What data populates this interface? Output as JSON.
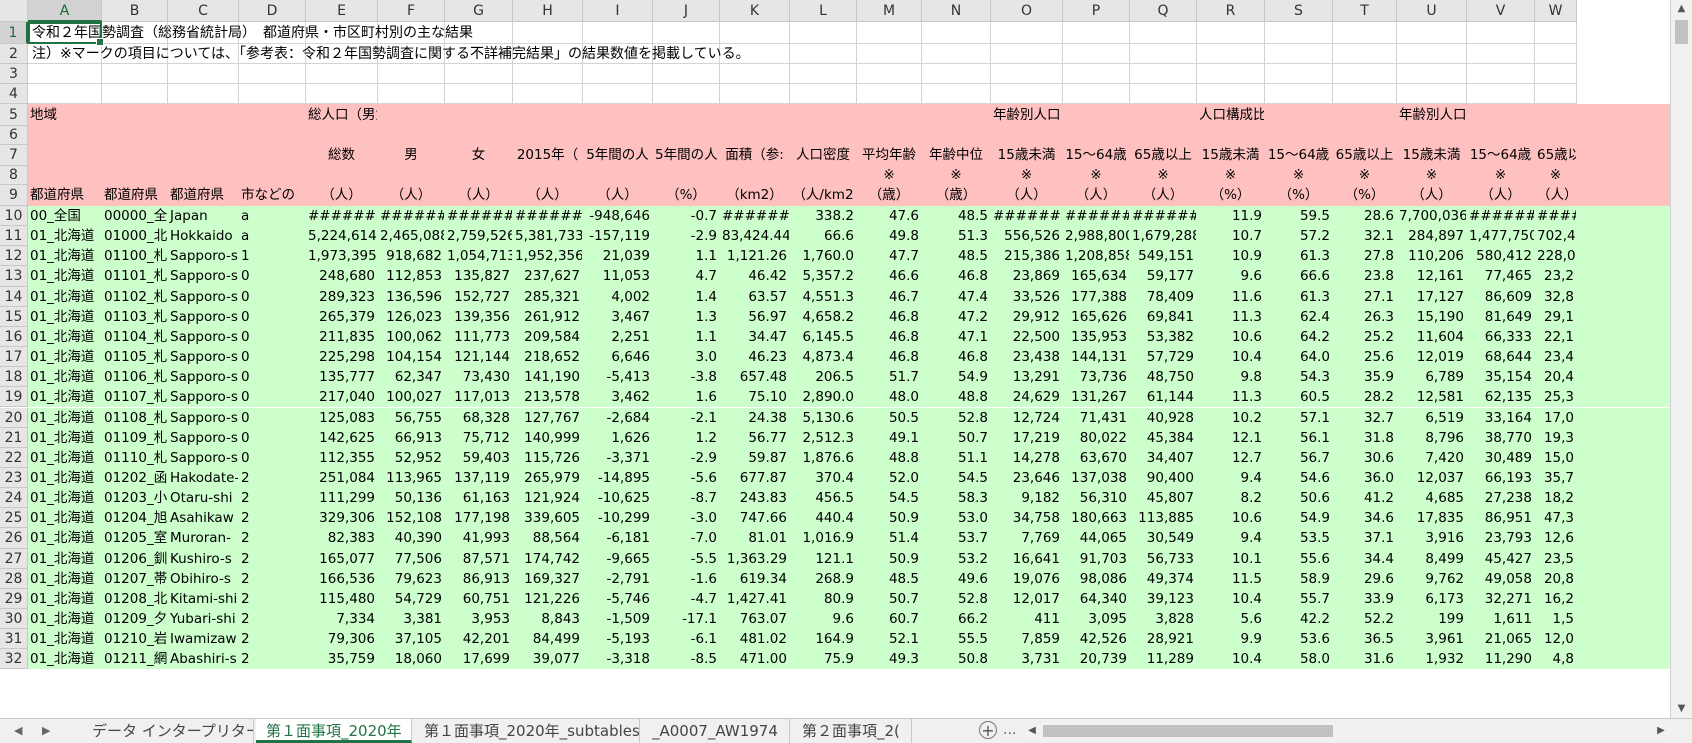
{
  "columns": [
    "A",
    "B",
    "C",
    "D",
    "E",
    "F",
    "G",
    "H",
    "I",
    "J",
    "K",
    "L",
    "M",
    "N",
    "O",
    "P",
    "Q",
    "R",
    "S",
    "T",
    "U",
    "V",
    "W"
  ],
  "selected_column": "A",
  "selected_row": "1",
  "colors": {
    "header_band": "#ffc0c0",
    "data_band": "#ccffcc",
    "accent": "#217346"
  },
  "row1_text": "令和２年国勢調査（総務省統計局）　都道府県・市区町村別の主な結果",
  "row2_text": "注）※マークの項目については、「参考表：令和２年国勢調査に関する不詳補完結果」の結果数値を掲載している。",
  "row5": {
    "A": "地域",
    "E": "総人口（男女別）",
    "O": "年齢別人口（男女「総数」）",
    "R": "人口構成比［年齢別］（男女",
    "U": "年齢別人口（男"
  },
  "row7": {
    "E": "総数",
    "F": "男",
    "G": "女",
    "H": "2015年（",
    "I": "5年間の人",
    "J": "5年間の人",
    "K": "面積（参:",
    "L": "人口密度",
    "M": "平均年齢",
    "N": "年齢中位",
    "O": "15歳未満",
    "P": "15～64歳",
    "Q": "65歳以上",
    "R": "15歳未満",
    "S": "15～64歳",
    "T": "65歳以上",
    "U": "15歳未満",
    "V": "15～64歳",
    "W": "65歳以"
  },
  "row8": {
    "M": "※",
    "N": "※",
    "O": "※",
    "P": "※",
    "Q": "※",
    "R": "※",
    "S": "※",
    "T": "※",
    "U": "※",
    "V": "※",
    "W": "※"
  },
  "row9": {
    "A": "都道府県",
    "B": "都道府県",
    "C": "都道府県",
    "D": "市などの",
    "E": "（人）",
    "F": "（人）",
    "G": "（人）",
    "H": "（人）",
    "I": "（人）",
    "J": "（%）",
    "K": "（km2）",
    "L": "（人/km2",
    "M": "（歳）",
    "N": "（歳）",
    "O": "（人）",
    "P": "（人）",
    "Q": "（人）",
    "R": "（%）",
    "S": "（%）",
    "T": "（%）",
    "U": "（人）",
    "V": "（人）",
    "W": "（人）"
  },
  "data_rows": [
    {
      "num": "10",
      "cells": [
        "00_全国",
        "00000_全",
        "Japan",
        "a",
        "########",
        "########",
        "########",
        "########",
        "-948,646",
        "-0.7",
        "########",
        "338.2",
        "47.6",
        "48.5",
        "########",
        "########",
        "########",
        "11.9",
        "59.5",
        "28.6",
        "7,700,036",
        "########",
        "#######"
      ]
    },
    {
      "num": "11",
      "cells": [
        "01_北海道",
        "01000_北",
        "Hokkaido",
        "a",
        "5,224,614",
        "2,465,088",
        "2,759,526",
        "5,381,733",
        "-157,119",
        "-2.9",
        "83,424.44",
        "66.6",
        "49.8",
        "51.3",
        "556,526",
        "2,988,800",
        "1,679,288",
        "10.7",
        "57.2",
        "32.1",
        "284,897",
        "1,477,750",
        "702,4"
      ]
    },
    {
      "num": "12",
      "cells": [
        "01_北海道",
        "01100_札",
        "Sapporo-s",
        "1",
        "1,973,395",
        "918,682",
        "1,054,713",
        "1,952,356",
        "21,039",
        "1.1",
        "1,121.26",
        "1,760.0",
        "47.7",
        "48.5",
        "215,386",
        "1,208,858",
        "549,151",
        "10.9",
        "61.3",
        "27.8",
        "110,206",
        "580,412",
        "228,0"
      ]
    },
    {
      "num": "13",
      "cells": [
        "01_北海道",
        "01101_札",
        "Sapporo-s",
        "0",
        "248,680",
        "112,853",
        "135,827",
        "237,627",
        "11,053",
        "4.7",
        "46.42",
        "5,357.2",
        "46.6",
        "46.8",
        "23,869",
        "165,634",
        "59,177",
        "9.6",
        "66.6",
        "23.8",
        "12,161",
        "77,465",
        "23,2"
      ]
    },
    {
      "num": "14",
      "cells": [
        "01_北海道",
        "01102_札",
        "Sapporo-s",
        "0",
        "289,323",
        "136,596",
        "152,727",
        "285,321",
        "4,002",
        "1.4",
        "63.57",
        "4,551.3",
        "46.7",
        "47.4",
        "33,526",
        "177,388",
        "78,409",
        "11.6",
        "61.3",
        "27.1",
        "17,127",
        "86,609",
        "32,8"
      ]
    },
    {
      "num": "15",
      "cells": [
        "01_北海道",
        "01103_札",
        "Sapporo-s",
        "0",
        "265,379",
        "126,023",
        "139,356",
        "261,912",
        "3,467",
        "1.3",
        "56.97",
        "4,658.2",
        "46.8",
        "47.2",
        "29,912",
        "165,626",
        "69,841",
        "11.3",
        "62.4",
        "26.3",
        "15,190",
        "81,649",
        "29,1"
      ]
    },
    {
      "num": "16",
      "cells": [
        "01_北海道",
        "01104_札",
        "Sapporo-s",
        "0",
        "211,835",
        "100,062",
        "111,773",
        "209,584",
        "2,251",
        "1.1",
        "34.47",
        "6,145.5",
        "46.8",
        "47.1",
        "22,500",
        "135,953",
        "53,382",
        "10.6",
        "64.2",
        "25.2",
        "11,604",
        "66,333",
        "22,1"
      ]
    },
    {
      "num": "17",
      "cells": [
        "01_北海道",
        "01105_札",
        "Sapporo-s",
        "0",
        "225,298",
        "104,154",
        "121,144",
        "218,652",
        "6,646",
        "3.0",
        "46.23",
        "4,873.4",
        "46.8",
        "46.8",
        "23,438",
        "144,131",
        "57,729",
        "10.4",
        "64.0",
        "25.6",
        "12,019",
        "68,644",
        "23,4"
      ]
    },
    {
      "num": "18",
      "cells": [
        "01_北海道",
        "01106_札",
        "Sapporo-s",
        "0",
        "135,777",
        "62,347",
        "73,430",
        "141,190",
        "-5,413",
        "-3.8",
        "657.48",
        "206.5",
        "51.7",
        "54.9",
        "13,291",
        "73,736",
        "48,750",
        "9.8",
        "54.3",
        "35.9",
        "6,789",
        "35,154",
        "20,4"
      ]
    },
    {
      "num": "19",
      "cells": [
        "01_北海道",
        "01107_札",
        "Sapporo-s",
        "0",
        "217,040",
        "100,027",
        "117,013",
        "213,578",
        "3,462",
        "1.6",
        "75.10",
        "2,890.0",
        "48.0",
        "48.8",
        "24,629",
        "131,267",
        "61,144",
        "11.3",
        "60.5",
        "28.2",
        "12,581",
        "62,135",
        "25,3"
      ]
    },
    {
      "num": "20",
      "cells": [
        "01_北海道",
        "01108_札",
        "Sapporo-s",
        "0",
        "125,083",
        "56,755",
        "68,328",
        "127,767",
        "-2,684",
        "-2.1",
        "24.38",
        "5,130.6",
        "50.5",
        "52.8",
        "12,724",
        "71,431",
        "40,928",
        "10.2",
        "57.1",
        "32.7",
        "6,519",
        "33,164",
        "17,0"
      ]
    },
    {
      "num": "21",
      "cells": [
        "01_北海道",
        "01109_札",
        "Sapporo-s",
        "0",
        "142,625",
        "66,913",
        "75,712",
        "140,999",
        "1,626",
        "1.2",
        "56.77",
        "2,512.3",
        "49.1",
        "50.7",
        "17,219",
        "80,022",
        "45,384",
        "12.1",
        "56.1",
        "31.8",
        "8,796",
        "38,770",
        "19,3"
      ]
    },
    {
      "num": "22",
      "cells": [
        "01_北海道",
        "01110_札",
        "Sapporo-s",
        "0",
        "112,355",
        "52,952",
        "59,403",
        "115,726",
        "-3,371",
        "-2.9",
        "59.87",
        "1,876.6",
        "48.8",
        "51.1",
        "14,278",
        "63,670",
        "34,407",
        "12.7",
        "56.7",
        "30.6",
        "7,420",
        "30,489",
        "15,0"
      ]
    },
    {
      "num": "23",
      "cells": [
        "01_北海道",
        "01202_函",
        "Hakodate-",
        "2",
        "251,084",
        "113,965",
        "137,119",
        "265,979",
        "-14,895",
        "-5.6",
        "677.87",
        "370.4",
        "52.0",
        "54.5",
        "23,646",
        "137,038",
        "90,400",
        "9.4",
        "54.6",
        "36.0",
        "12,037",
        "66,193",
        "35,7"
      ]
    },
    {
      "num": "24",
      "cells": [
        "01_北海道",
        "01203_小",
        "Otaru-shi",
        "2",
        "111,299",
        "50,136",
        "61,163",
        "121,924",
        "-10,625",
        "-8.7",
        "243.83",
        "456.5",
        "54.5",
        "58.3",
        "9,182",
        "56,310",
        "45,807",
        "8.2",
        "50.6",
        "41.2",
        "4,685",
        "27,238",
        "18,2"
      ]
    },
    {
      "num": "25",
      "cells": [
        "01_北海道",
        "01204_旭",
        "Asahikaw",
        "2",
        "329,306",
        "152,108",
        "177,198",
        "339,605",
        "-10,299",
        "-3.0",
        "747.66",
        "440.4",
        "50.9",
        "53.0",
        "34,758",
        "180,663",
        "113,885",
        "10.6",
        "54.9",
        "34.6",
        "17,835",
        "86,951",
        "47,3"
      ]
    },
    {
      "num": "26",
      "cells": [
        "01_北海道",
        "01205_室",
        "Muroran-",
        "2",
        "82,383",
        "40,390",
        "41,993",
        "88,564",
        "-6,181",
        "-7.0",
        "81.01",
        "1,016.9",
        "51.4",
        "53.7",
        "7,769",
        "44,065",
        "30,549",
        "9.4",
        "53.5",
        "37.1",
        "3,916",
        "23,793",
        "12,6"
      ]
    },
    {
      "num": "27",
      "cells": [
        "01_北海道",
        "01206_釧",
        "Kushiro-s",
        "2",
        "165,077",
        "77,506",
        "87,571",
        "174,742",
        "-9,665",
        "-5.5",
        "1,363.29",
        "121.1",
        "50.9",
        "53.2",
        "16,641",
        "91,703",
        "56,733",
        "10.1",
        "55.6",
        "34.4",
        "8,499",
        "45,427",
        "23,5"
      ]
    },
    {
      "num": "28",
      "cells": [
        "01_北海道",
        "01207_帯",
        "Obihiro-s",
        "2",
        "166,536",
        "79,623",
        "86,913",
        "169,327",
        "-2,791",
        "-1.6",
        "619.34",
        "268.9",
        "48.5",
        "49.6",
        "19,076",
        "98,086",
        "49,374",
        "11.5",
        "58.9",
        "29.6",
        "9,762",
        "49,058",
        "20,8"
      ]
    },
    {
      "num": "29",
      "cells": [
        "01_北海道",
        "01208_北",
        "Kitami-shi",
        "2",
        "115,480",
        "54,729",
        "60,751",
        "121,226",
        "-5,746",
        "-4.7",
        "1,427.41",
        "80.9",
        "50.7",
        "52.8",
        "12,017",
        "64,340",
        "39,123",
        "10.4",
        "55.7",
        "33.9",
        "6,173",
        "32,271",
        "16,2"
      ]
    },
    {
      "num": "30",
      "cells": [
        "01_北海道",
        "01209_夕",
        "Yubari-shi",
        "2",
        "7,334",
        "3,381",
        "3,953",
        "8,843",
        "-1,509",
        "-17.1",
        "763.07",
        "9.6",
        "60.7",
        "66.2",
        "411",
        "3,095",
        "3,828",
        "5.6",
        "42.2",
        "52.2",
        "199",
        "1,611",
        "1,5"
      ]
    },
    {
      "num": "31",
      "cells": [
        "01_北海道",
        "01210_岩",
        "Iwamizaw",
        "2",
        "79,306",
        "37,105",
        "42,201",
        "84,499",
        "-5,193",
        "-6.1",
        "481.02",
        "164.9",
        "52.1",
        "55.5",
        "7,859",
        "42,526",
        "28,921",
        "9.9",
        "53.6",
        "36.5",
        "3,961",
        "21,065",
        "12,0"
      ]
    },
    {
      "num": "32",
      "cells": [
        "01_北海道",
        "01211_網",
        "Abashiri-s",
        "2",
        "35,759",
        "18,060",
        "17,699",
        "39,077",
        "-3,318",
        "-8.5",
        "471.00",
        "75.9",
        "49.3",
        "50.8",
        "3,731",
        "20,739",
        "11,289",
        "10.4",
        "58.0",
        "31.6",
        "1,932",
        "11,290",
        "4,8"
      ]
    }
  ],
  "sheet_tabs": [
    {
      "label": "データ インタープリターのコツ",
      "active": false
    },
    {
      "label": "第１面事項_2020年",
      "active": true
    },
    {
      "label": "第１面事項_2020年_subtables",
      "active": false
    },
    {
      "label": "_A0007_AW1974",
      "active": false
    },
    {
      "label": "第２面事項_2(",
      "active": false
    }
  ],
  "tabbar": {
    "add_sheet": "+",
    "more": "..."
  },
  "icons": {
    "tab_prev": "triangle-left-icon",
    "tab_next": "triangle-right-icon",
    "scroll_up": "triangle-up-icon",
    "scroll_down": "triangle-down-icon"
  }
}
